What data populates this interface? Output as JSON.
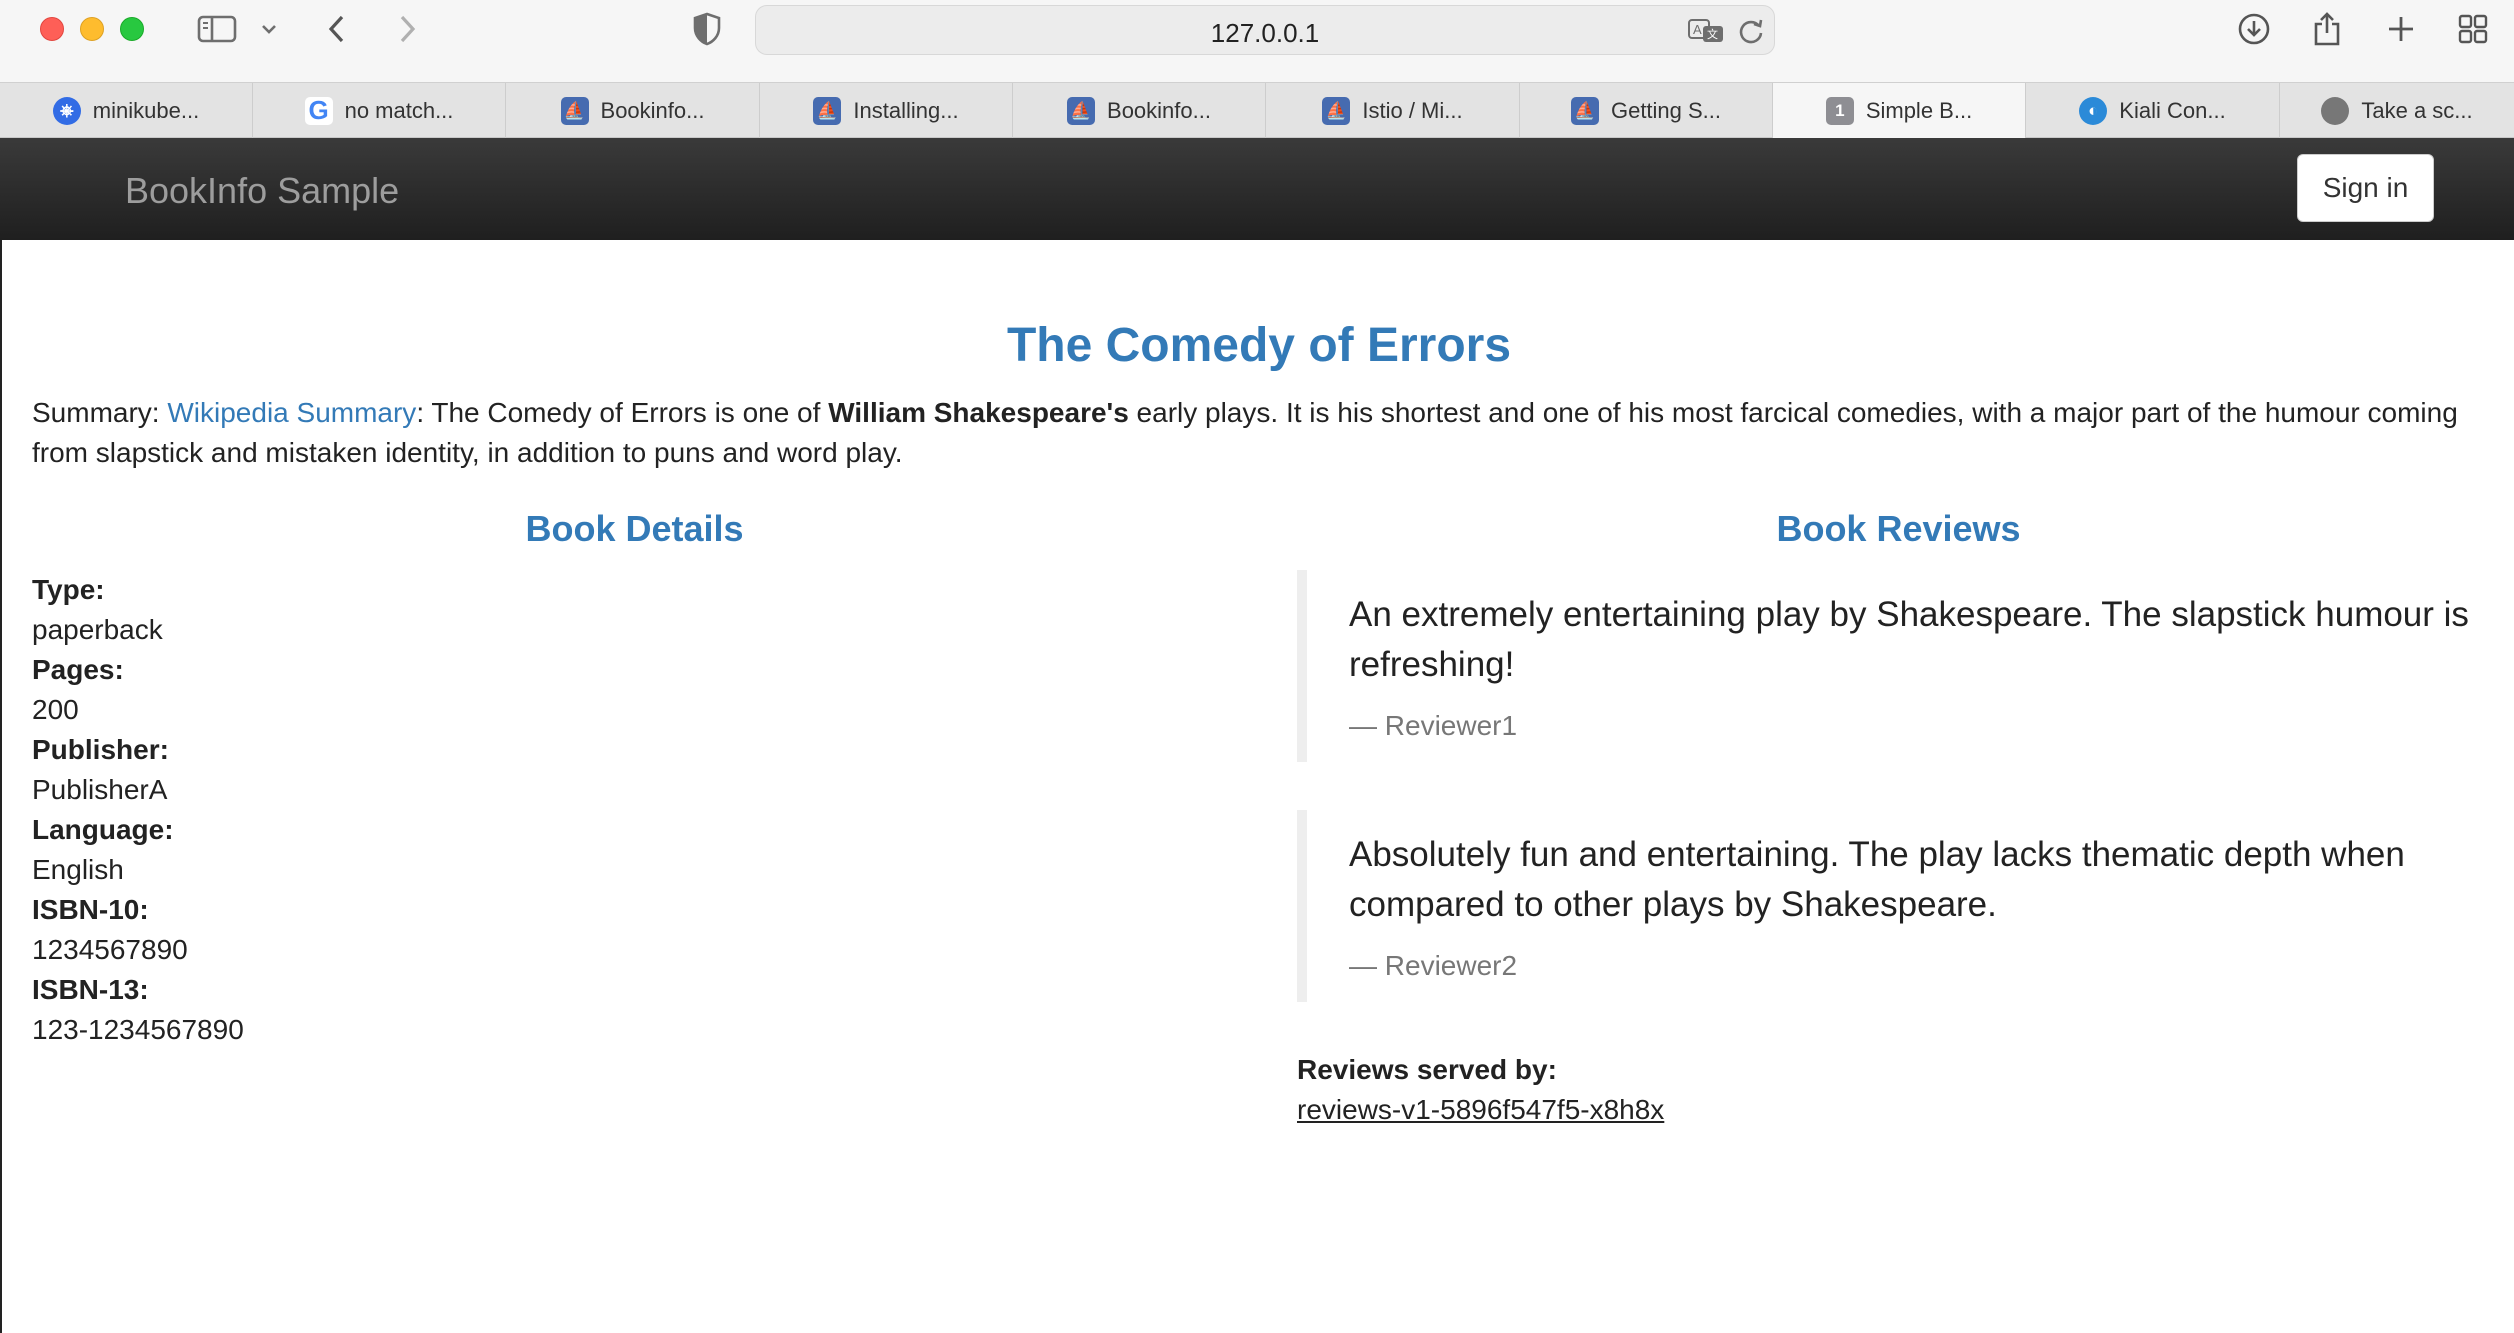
{
  "browser": {
    "url": "127.0.0.1",
    "tabs": [
      {
        "label": "minikube...",
        "icon": "minikube-icon",
        "active": false
      },
      {
        "label": "no match...",
        "icon": "google-icon",
        "active": false
      },
      {
        "label": "Bookinfo...",
        "icon": "istio-icon",
        "active": false
      },
      {
        "label": "Installing...",
        "icon": "istio-icon",
        "active": false
      },
      {
        "label": "Bookinfo...",
        "icon": "istio-icon",
        "active": false
      },
      {
        "label": "Istio / Mi...",
        "icon": "istio-icon",
        "active": false
      },
      {
        "label": "Getting S...",
        "icon": "istio-icon",
        "active": false
      },
      {
        "label": "Simple B...",
        "icon": "numbered-tab-icon",
        "badge": "1",
        "active": true
      },
      {
        "label": "Kiali Con...",
        "icon": "kiali-icon",
        "active": false
      },
      {
        "label": "Take a sc...",
        "icon": "apple-icon",
        "active": false
      }
    ]
  },
  "navbar": {
    "brand": "BookInfo Sample",
    "signin_label": "Sign in"
  },
  "book": {
    "title": "The Comedy of Errors",
    "summary_prefix": "Summary: ",
    "summary_link": "Wikipedia Summary",
    "summary_mid": ": The Comedy of Errors is one of ",
    "summary_author": "William Shakespeare's",
    "summary_rest": " early plays. It is his shortest and one of his most farcical comedies, with a major part of the humour coming from slapstick and mistaken identity, in addition to puns and word play."
  },
  "details": {
    "heading": "Book Details",
    "fields": [
      {
        "label": "Type:",
        "value": "paperback"
      },
      {
        "label": "Pages:",
        "value": "200"
      },
      {
        "label": "Publisher:",
        "value": "PublisherA"
      },
      {
        "label": "Language:",
        "value": "English"
      },
      {
        "label": "ISBN-10:",
        "value": "1234567890"
      },
      {
        "label": "ISBN-13:",
        "value": "123-1234567890"
      }
    ]
  },
  "reviews": {
    "heading": "Book Reviews",
    "items": [
      {
        "text": "An extremely entertaining play by Shakespeare. The slapstick humour is refreshing!",
        "reviewer": "— Reviewer1"
      },
      {
        "text": "Absolutely fun and entertaining. The play lacks thematic depth when compared to other plays by Shakespeare.",
        "reviewer": "— Reviewer2"
      }
    ],
    "served_label": "Reviews served by:",
    "served_pod": "reviews-v1-5896f547f5-x8h8x"
  },
  "colors": {
    "accent": "#337ab7",
    "navbar": "#222222"
  }
}
